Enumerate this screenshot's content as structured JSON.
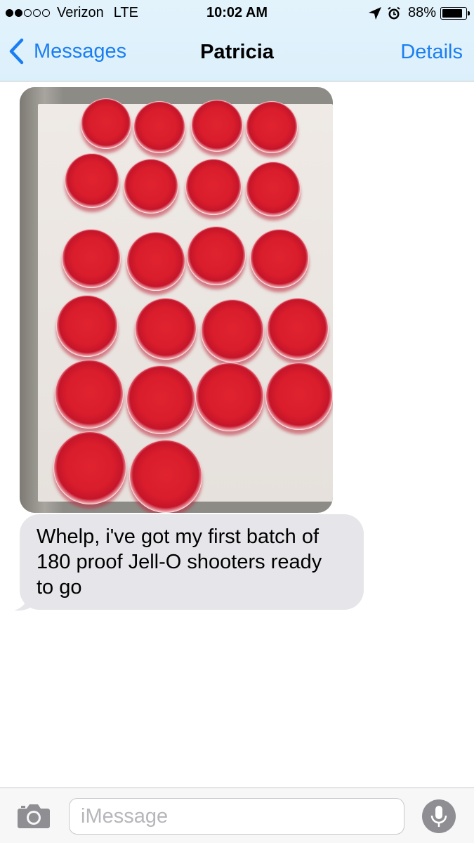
{
  "status_bar": {
    "carrier": "Verizon",
    "network": "LTE",
    "signal_bars": 2,
    "signal_total": 5,
    "time": "10:02 AM",
    "battery_percent": "88%",
    "battery_level": 0.88,
    "icons": [
      "location-arrow-icon",
      "alarm-clock-icon",
      "battery-icon"
    ]
  },
  "nav": {
    "back_label": "Messages",
    "title": "Patricia",
    "details_label": "Details"
  },
  "conversation": {
    "messages": [
      {
        "type": "image",
        "direction": "incoming",
        "content": "photo"
      },
      {
        "type": "text",
        "direction": "incoming",
        "lines": [
          "Whelp, i've got my first batch of",
          "180 proof Jell-O shooters ready",
          "to go"
        ]
      }
    ]
  },
  "input_bar": {
    "placeholder": "iMessage",
    "icons": [
      "camera-icon",
      "microphone-icon"
    ]
  },
  "colors": {
    "accent": "#1a7ef2",
    "incoming_bubble": "#e5e5ea",
    "nav_background": "#dcf0fb"
  }
}
